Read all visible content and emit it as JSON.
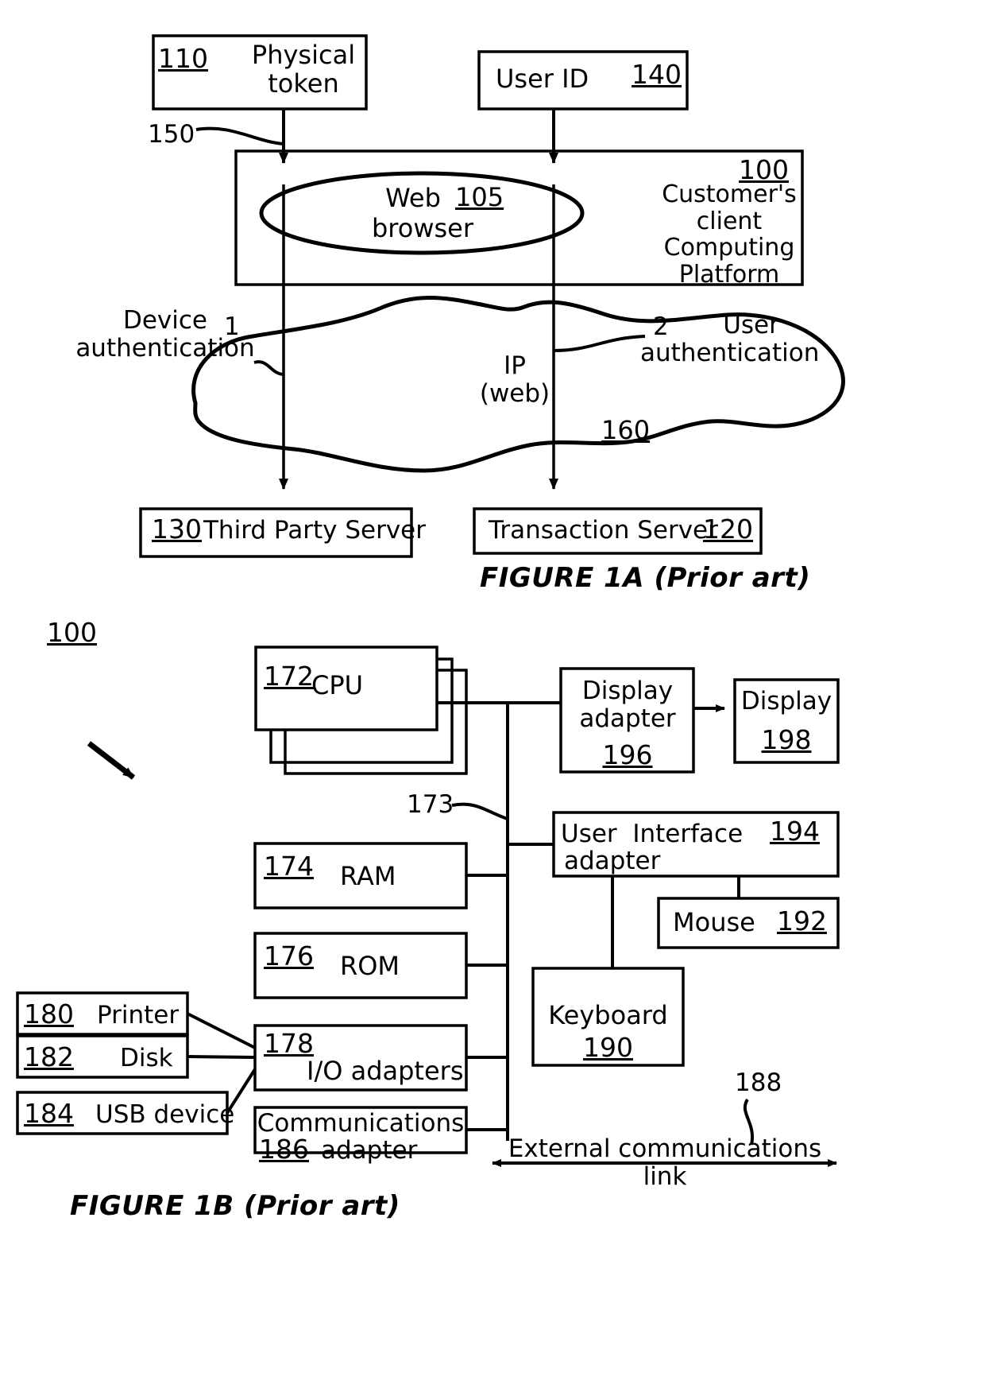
{
  "figure_1a": {
    "caption": "FIGURE 1A (Prior art)",
    "boxes": {
      "physical_token": {
        "ref": "110",
        "label": "Physical\ntoken"
      },
      "user_id": {
        "ref": "140",
        "label": "User ID"
      },
      "platform": {
        "ref": "100",
        "label": "Customer's\nclient\nComputing\nPlatform"
      },
      "web_browser": {
        "ref": "105",
        "label_line1": "Web",
        "label_line2": "browser"
      },
      "third_party_server": {
        "ref": "130",
        "label": "Third Party Server"
      },
      "transaction_server": {
        "ref": "120",
        "label": "Transaction Server"
      }
    },
    "annotations": {
      "lead_150": "150",
      "device_auth": "Device\nauthentication",
      "marker_1": "1",
      "marker_2": "2",
      "user_auth": "User\nauthentication",
      "ip_web": "IP\n(web)",
      "network_ref": "160"
    }
  },
  "figure_1b": {
    "caption": "FIGURE 1B (Prior art)",
    "system_ref": "100",
    "bus_ref": "173",
    "link_ref": "188",
    "boxes": {
      "cpu": {
        "ref": "172",
        "label": "CPU"
      },
      "display_adapter": {
        "ref": "196",
        "label": "Display\nadapter"
      },
      "display": {
        "ref": "198",
        "label": "Display"
      },
      "ram": {
        "ref": "174",
        "label": "RAM"
      },
      "rom": {
        "ref": "176",
        "label": "ROM"
      },
      "io_adapters": {
        "ref": "178",
        "label": "I/O adapters"
      },
      "comms_adapter": {
        "ref": "186",
        "label_line1": "Communications",
        "label_line2": "adapter"
      },
      "printer": {
        "ref": "180",
        "label": "Printer"
      },
      "disk": {
        "ref": "182",
        "label": "Disk"
      },
      "usb_device": {
        "ref": "184",
        "label": "USB device"
      },
      "ui_adapter": {
        "ref": "194",
        "label_line1": "User  Interface",
        "label_line2": "adapter"
      },
      "mouse": {
        "ref": "192",
        "label": "Mouse"
      },
      "keyboard": {
        "ref": "190",
        "label": "Keyboard"
      }
    },
    "annotations": {
      "external_link": "External communications\nlink"
    }
  },
  "style": {
    "ink": "#000000",
    "paper": "#ffffff"
  }
}
